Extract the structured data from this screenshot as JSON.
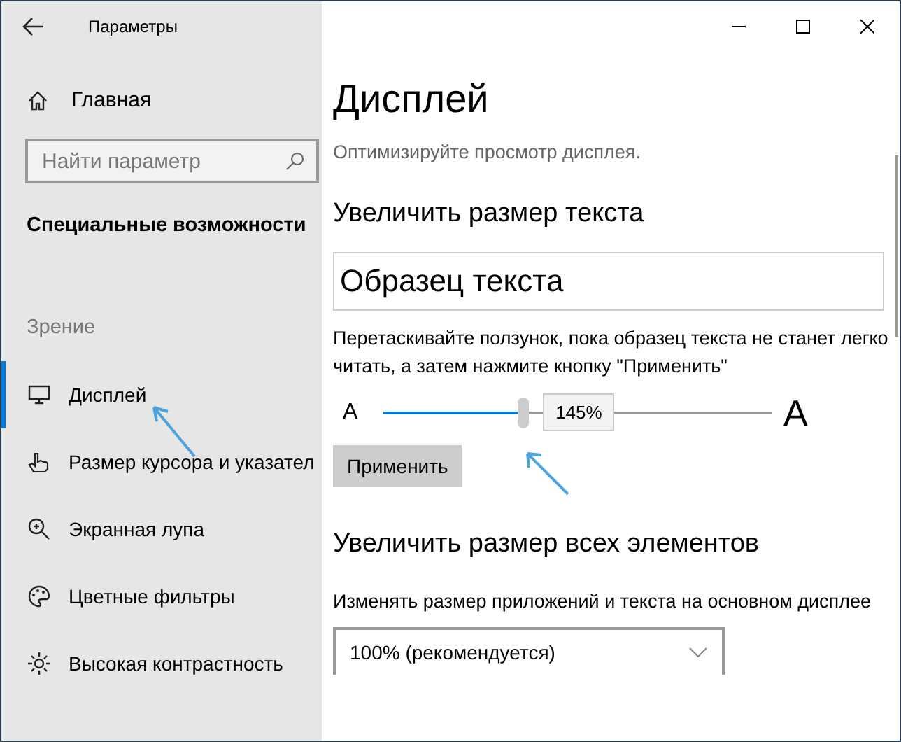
{
  "window": {
    "title": "Параметры"
  },
  "sidebar": {
    "home": "Главная",
    "search": {
      "placeholder": "Найти параметр"
    },
    "section_title": "Специальные возможности",
    "group_label": "Зрение",
    "items": [
      {
        "label": "Дисплей",
        "selected": true
      },
      {
        "label": "Размер курсора и указател",
        "selected": false
      },
      {
        "label": "Экранная лупа",
        "selected": false
      },
      {
        "label": "Цветные фильтры",
        "selected": false
      },
      {
        "label": "Высокая контрастность",
        "selected": false
      }
    ]
  },
  "main": {
    "title": "Дисплей",
    "subtitle": "Оптимизируйте просмотр дисплея.",
    "text_size": {
      "heading": "Увеличить размер текста",
      "sample": "Образец текста",
      "instructions": "Перетаскивайте ползунок, пока образец текста не станет легко читать, а затем нажмите кнопку \"Применить\"",
      "slider": {
        "min_label": "A",
        "max_label": "A",
        "level": 0.36,
        "reading": "145%"
      },
      "apply_button": "Применить"
    },
    "scale": {
      "heading": "Увеличить размер всех элементов",
      "description": "Изменять размер приложений и текста на основном дисплее",
      "dropdown": {
        "value": "100% (рекомендуется)"
      }
    }
  }
}
